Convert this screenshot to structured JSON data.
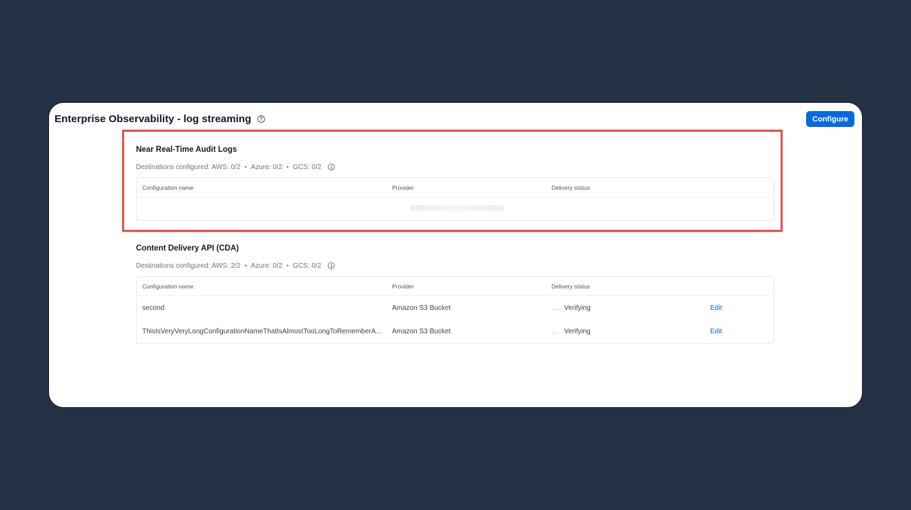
{
  "header": {
    "title": "Enterprise Observability - log streaming",
    "help_icon": "question-circle-icon",
    "configure_label": "Configure"
  },
  "colors": {
    "background": "#233145",
    "accent": "#0a6ad9",
    "highlight": "#e0544f",
    "link": "#1a5fd0"
  },
  "sections": [
    {
      "title": "Near Real-Time Audit Logs",
      "destinations": {
        "aws": "Destinations configured: AWS: 0/2",
        "azure": "Azure: 0/2",
        "gcs": "GCS: 0/2",
        "separator": "•"
      },
      "columns": [
        "Configuration name",
        "Provider",
        "Delivery status"
      ],
      "rows": [],
      "loading": true
    },
    {
      "title": "Content Delivery API (CDA)",
      "destinations": {
        "aws": "Destinations configured: AWS: 2/2",
        "azure": "Azure: 0/2",
        "gcs": "GCS: 0/2",
        "separator": "•"
      },
      "columns": [
        "Configuration name",
        "Provider",
        "Delivery status"
      ],
      "rows": [
        {
          "name": "second",
          "provider": "Amazon S3 Bucket",
          "status_icon": "...",
          "status": "Verifying",
          "action": "Edit"
        },
        {
          "name": "ThisIsVeryVeryLongConfigurationNameThatIsAlmostTooLongToRememberAndType",
          "provider": "Amazon S3 Bucket",
          "status_icon": "...",
          "status": "Verifying",
          "action": "Edit"
        }
      ]
    }
  ]
}
